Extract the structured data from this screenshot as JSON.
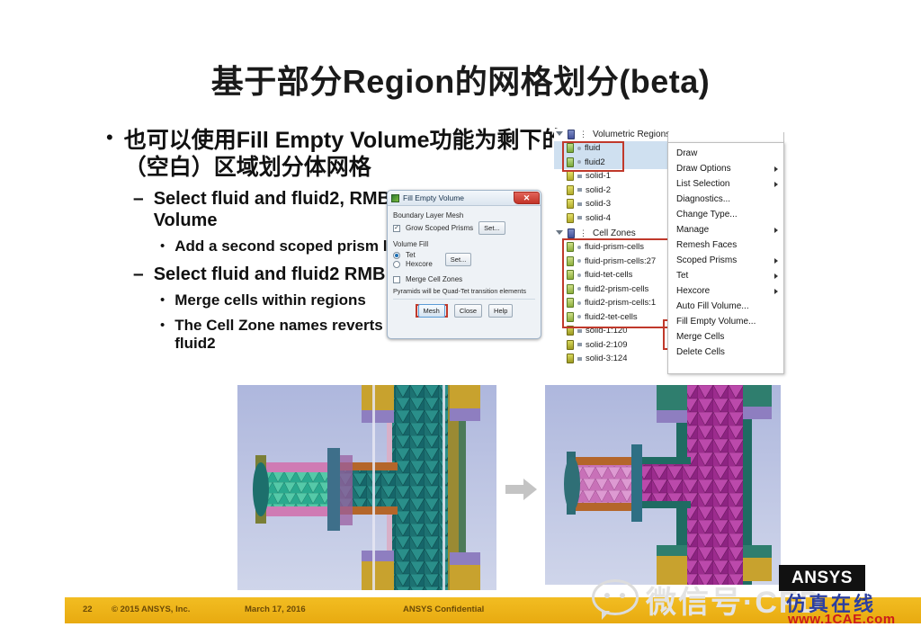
{
  "slide": {
    "title": "基于部分Region的网格划分(beta)"
  },
  "bullets": {
    "level1": "也可以使用Fill Empty Volume功能为剩下的（空白）区域划分体网格",
    "items": [
      {
        "text": "Select fluid and fluid2, RMB -> Fill Empty Volume",
        "sub": [
          "Add a second scoped prism layer!"
        ]
      },
      {
        "text": "Select fluid and fluid2 RMB ->  Merge Cells",
        "sub": [
          "Merge cells within regions",
          "The Cell Zone names reverts back to fluid and fluid2"
        ]
      }
    ]
  },
  "dialog": {
    "title": "Fill Empty Volume",
    "close_label": "✕",
    "group_blm": "Boundary Layer Mesh",
    "grow_scoped_prisms": "Grow Scoped Prisms",
    "set_btn_1": "Set...",
    "group_volfill": "Volume Fill",
    "opt_tet": "Tet",
    "opt_hexcore": "Hexcore",
    "set_btn_2": "Set...",
    "merge_cell_zones": "Merge Cell Zones",
    "note": "Pyramids will be Quad-Tet transition elements",
    "btn_mesh": "Mesh",
    "btn_close": "Close",
    "btn_help": "Help"
  },
  "tree": {
    "volumetric_regions_label": "Volumetric Regions",
    "volumetric_items": [
      {
        "label": "fluid",
        "selected": true
      },
      {
        "label": "fluid2",
        "selected": true
      },
      {
        "label": "solid-1",
        "selected": false
      },
      {
        "label": "solid-2",
        "selected": false
      },
      {
        "label": "solid-3",
        "selected": false
      },
      {
        "label": "solid-4",
        "selected": false
      }
    ],
    "cell_zones_label": "Cell Zones",
    "cell_zone_items": [
      {
        "label": "fluid-prism-cells"
      },
      {
        "label": "fluid-prism-cells:27"
      },
      {
        "label": "fluid-tet-cells"
      },
      {
        "label": "fluid2-prism-cells"
      },
      {
        "label": "fluid2-prism-cells:1"
      },
      {
        "label": "fluid2-tet-cells"
      },
      {
        "label": "solid-1:120"
      },
      {
        "label": "solid-2:109"
      },
      {
        "label": "solid-3:124"
      }
    ]
  },
  "context_menu": {
    "items": [
      {
        "label": "Draw",
        "submenu": false
      },
      {
        "label": "Draw Options",
        "submenu": true
      },
      {
        "label": "List Selection",
        "submenu": true
      },
      {
        "label": "Diagnostics...",
        "submenu": false
      },
      {
        "label": "Change Type...",
        "submenu": false
      },
      {
        "label": "Manage",
        "submenu": true
      },
      {
        "label": "Remesh Faces",
        "submenu": false
      },
      {
        "label": "Scoped Prisms",
        "submenu": true
      },
      {
        "label": "Tet",
        "submenu": true
      },
      {
        "label": "Hexcore",
        "submenu": true
      },
      {
        "label": "Auto Fill Volume...",
        "submenu": false
      },
      {
        "label": "Fill Empty Volume...",
        "submenu": false
      },
      {
        "label": "Merge Cells",
        "submenu": false
      },
      {
        "label": "Delete Cells",
        "submenu": false
      }
    ]
  },
  "footer": {
    "page": "22",
    "copyright": "© 2015 ANSYS, Inc.",
    "date": "March 17, 2016",
    "confidential": "ANSYS Confidential",
    "logo": "ANSYS"
  },
  "watermark": {
    "wechat_cn": "微信号·CFD",
    "blue_cn": "仿真在线",
    "url": "www.1CAE.com"
  },
  "colors": {
    "accent_gold": "#f2bd22",
    "highlight_red": "#c0392b",
    "selection_blue": "#cfe0f0",
    "watermark_blue": "#2b3fa0",
    "watermark_red": "#cc1b1b"
  }
}
